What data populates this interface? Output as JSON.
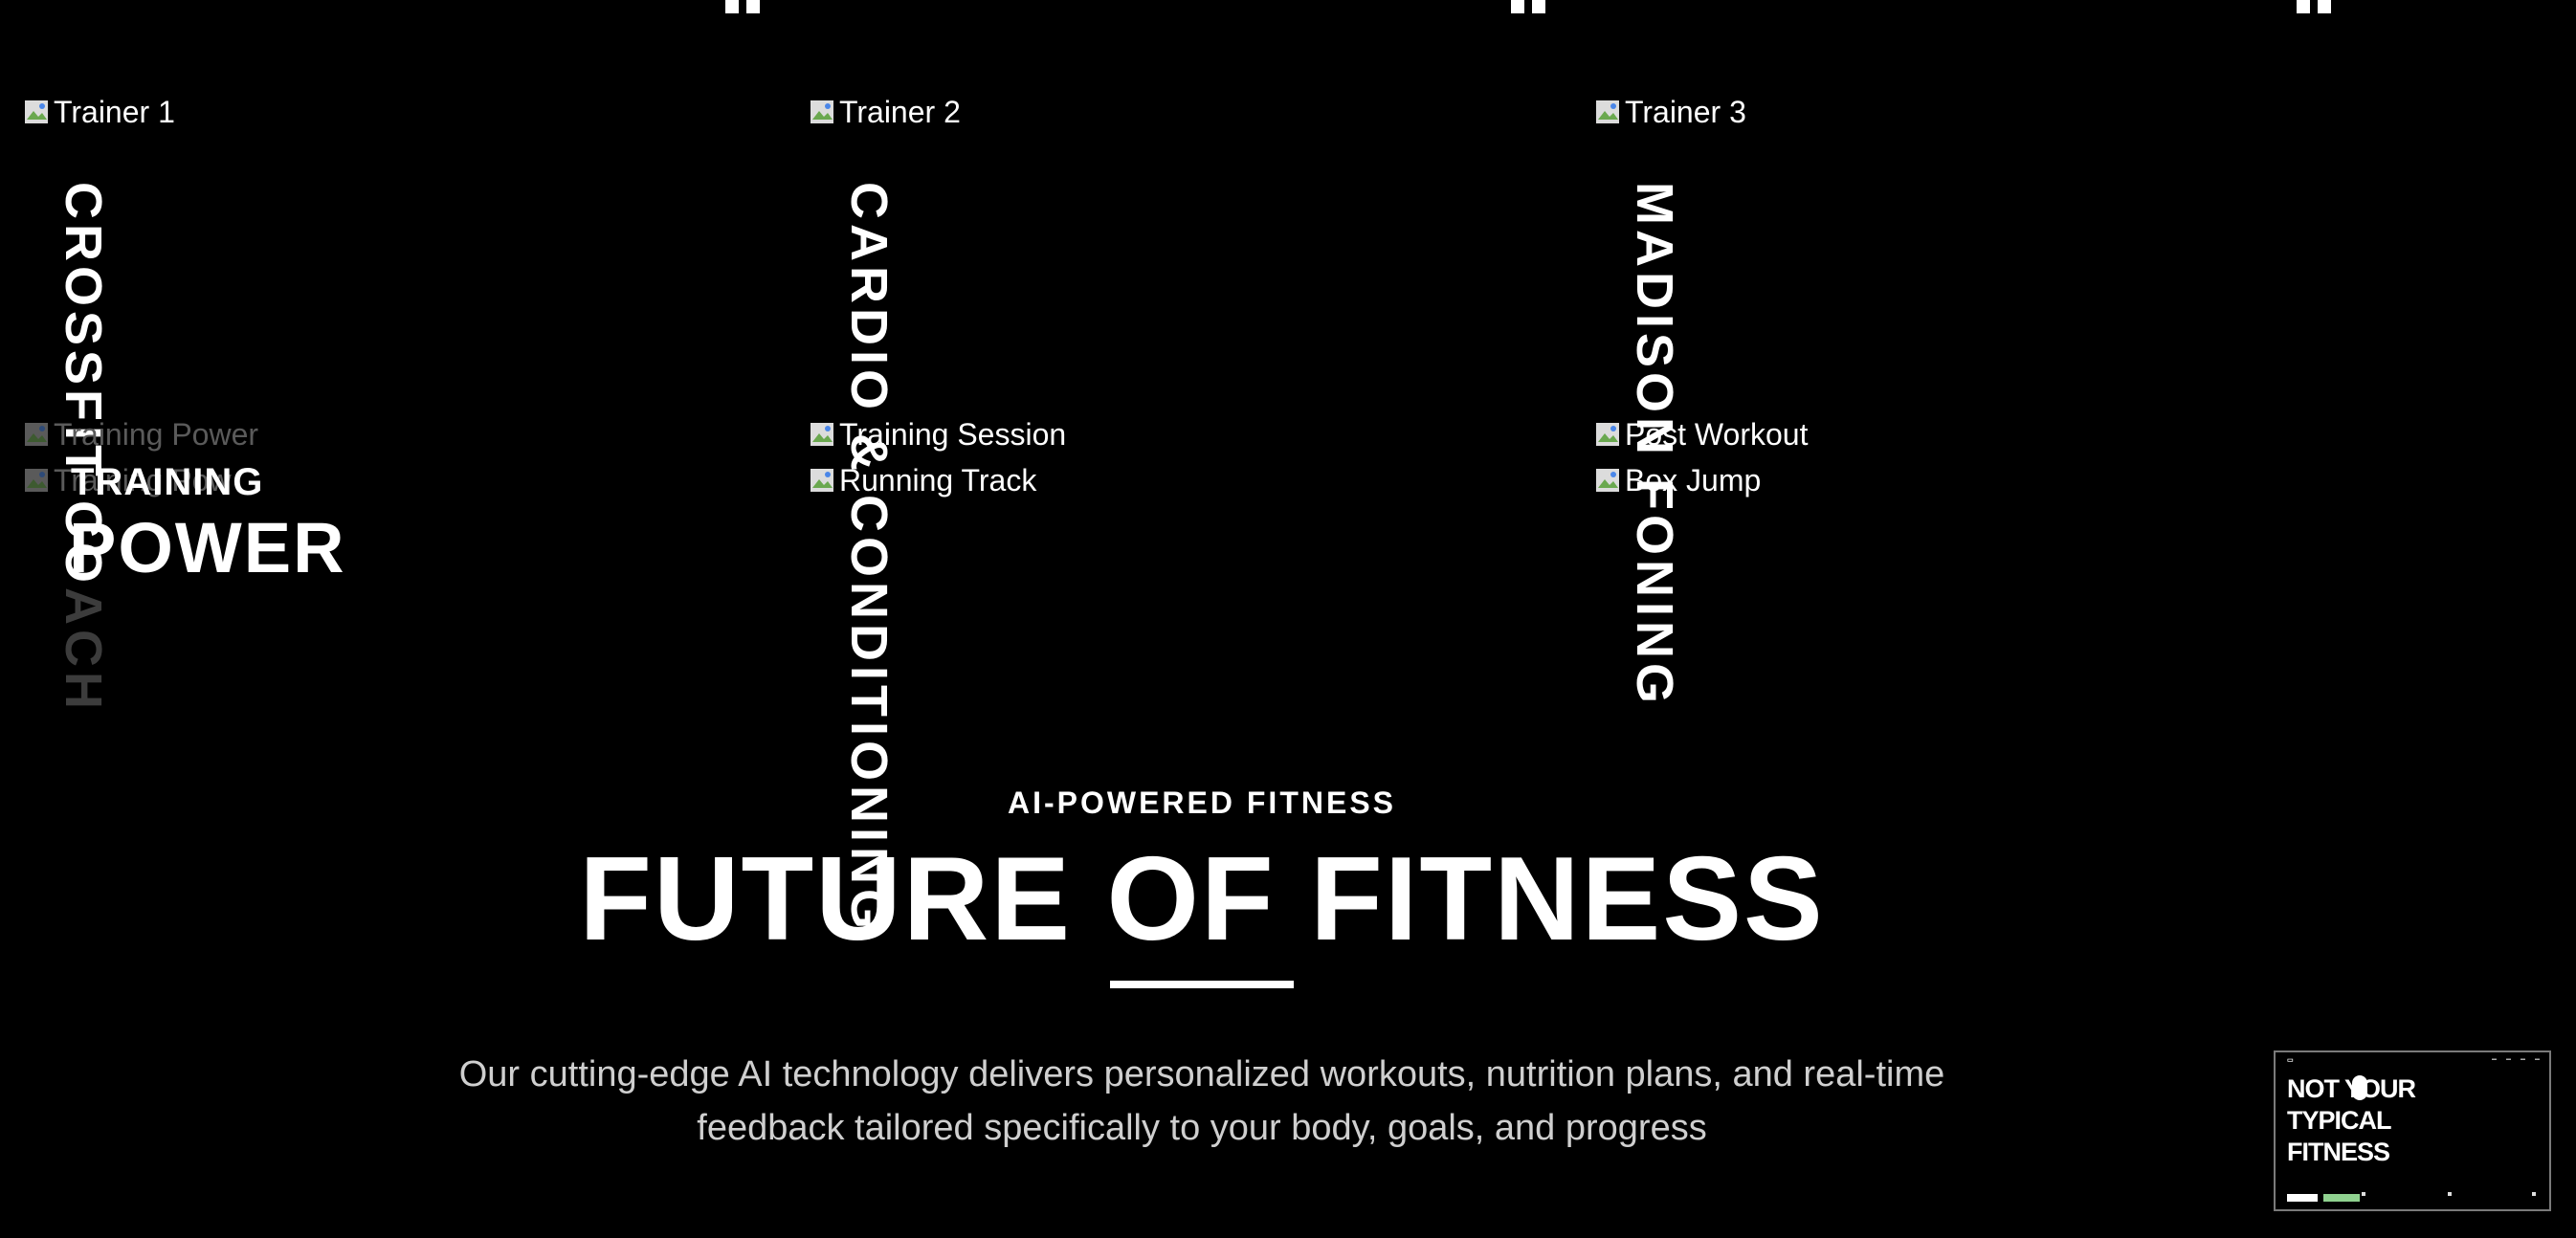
{
  "trainers": [
    {
      "photo_alt": "Trainer 1",
      "title_main": "CROSSFIT CO",
      "title_faded": "ACH",
      "gallery": [
        "Training Power",
        "Training Pow"
      ]
    },
    {
      "photo_alt": "Trainer 2",
      "title_main": "CARDIO & CONDITIONING",
      "title_faded": "",
      "gallery": [
        "Training Session",
        "Running Track"
      ]
    },
    {
      "photo_alt": "Trainer 3",
      "title_main": "MADISON FONING",
      "title_faded": "",
      "gallery": [
        "Post Workout",
        "Box Jump"
      ]
    }
  ],
  "overlay": {
    "line1": "TRAINING",
    "line2": "POWER"
  },
  "hero": {
    "eyebrow": "AI-POWERED FITNESS",
    "title": "FUTURE OF FITNESS",
    "description": "Our cutting-edge AI technology delivers personalized workouts, nutrition plans, and real-time feedback tailored specifically to your body, goals, and progress"
  },
  "preview_thumbnail": {
    "title": "NOT YOUR\nTYPICAL\nFITNESS"
  },
  "icons": {
    "broken_image": "broken-image-icon",
    "top_marker": "tab-marker-icon"
  }
}
